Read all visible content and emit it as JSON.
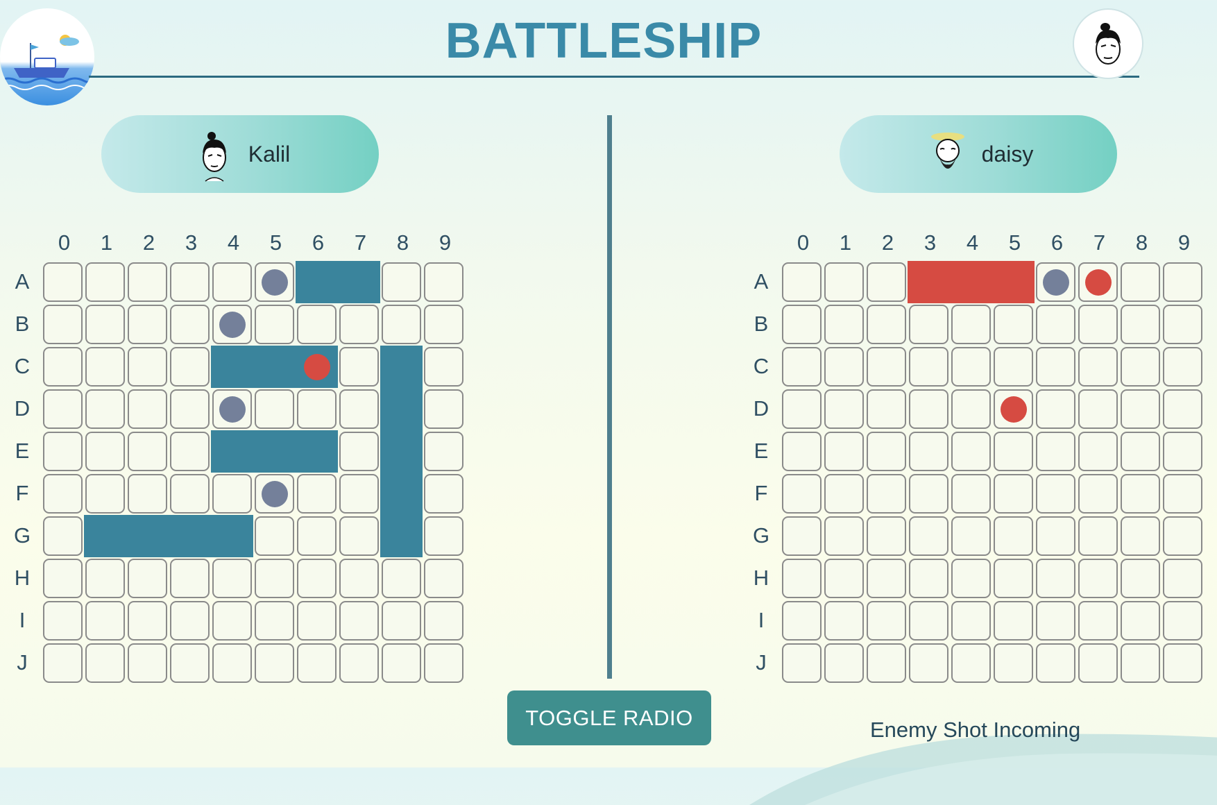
{
  "header": {
    "title": "BATTLESHIP"
  },
  "players": {
    "left": {
      "name": "Kalil"
    },
    "right": {
      "name": "daisy"
    }
  },
  "grid": {
    "columns": [
      "0",
      "1",
      "2",
      "3",
      "4",
      "5",
      "6",
      "7",
      "8",
      "9"
    ],
    "rows": [
      "A",
      "B",
      "C",
      "D",
      "E",
      "F",
      "G",
      "H",
      "I",
      "J"
    ]
  },
  "boards": {
    "left": {
      "ships": [
        "A6",
        "A7",
        "C4",
        "C5",
        "C6",
        "C8",
        "D8",
        "E4",
        "E5",
        "E6",
        "E8",
        "F8",
        "G1",
        "G2",
        "G3",
        "G4",
        "G8"
      ],
      "hit_ships": [],
      "misses": [
        "A5",
        "B4",
        "D4",
        "F5"
      ],
      "hits": [
        "C6"
      ]
    },
    "right": {
      "ships": [],
      "hit_ships": [
        "A3",
        "A4",
        "A5"
      ],
      "misses": [
        "A6"
      ],
      "hits": [
        "A7",
        "D5"
      ]
    }
  },
  "controls": {
    "toggle_radio_label": "TOGGLE RADIO"
  },
  "status": {
    "message": "Enemy Shot Incoming"
  },
  "colors": {
    "ship": "#3a849c",
    "hit": "#d64b42",
    "miss": "#74809a",
    "title": "#3a8aa8"
  },
  "icons": {
    "logo": "boat-logo-icon",
    "top_avatar": "user-avatar-icon"
  }
}
